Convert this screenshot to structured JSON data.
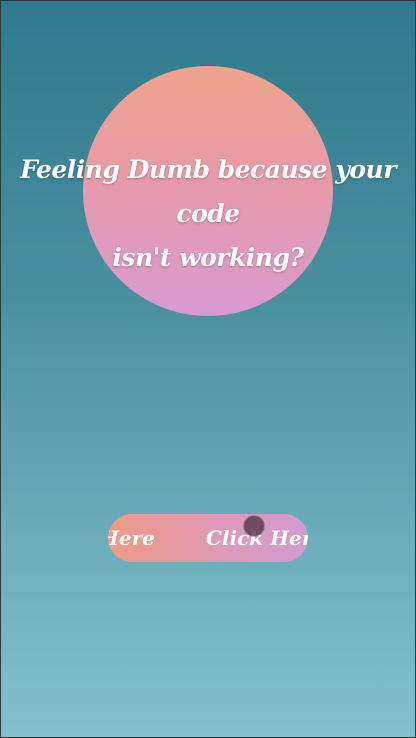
{
  "hero": {
    "headline_line1": "Feeling Dumb because your code",
    "headline_line2": "isn't working?"
  },
  "button": {
    "label_left": "Here",
    "label_right": "Click Here"
  },
  "colors": {
    "background_top": "#2e7a8c",
    "background_bottom": "#82c0cc",
    "circle_top": "#f0a38c",
    "circle_bottom": "#d89ad0",
    "button_left": "#ee9a84",
    "button_right": "#d49bcf",
    "cursor": "#5a3c55"
  }
}
